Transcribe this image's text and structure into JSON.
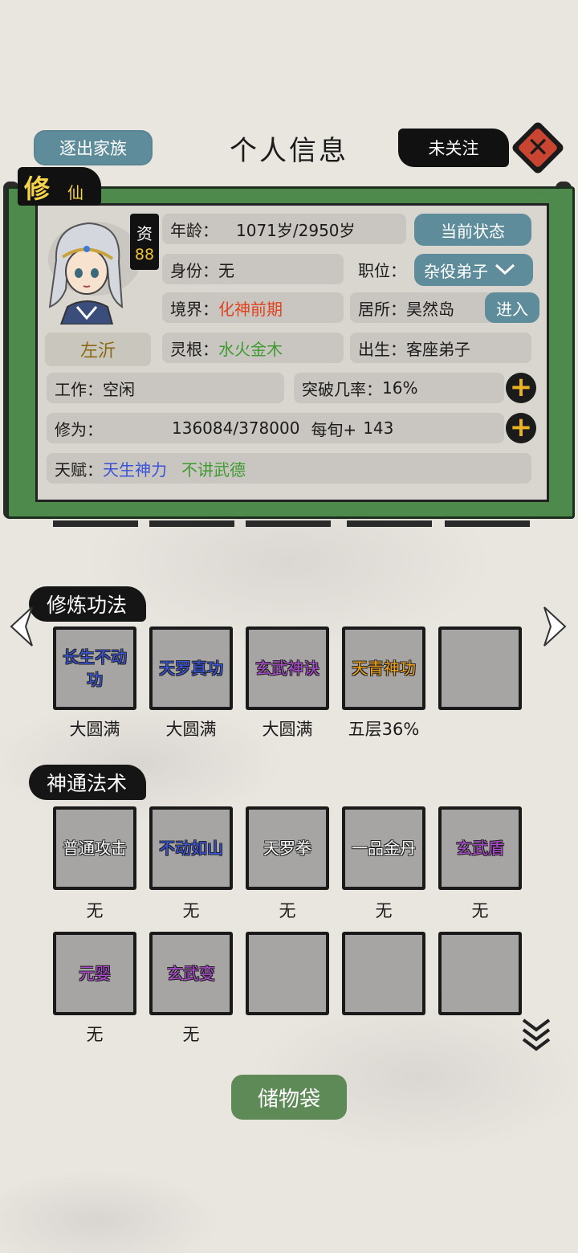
{
  "header": {
    "expel_label": "逐出家族",
    "title": "个人信息",
    "follow_label": "未关注",
    "close_icon": "close-icon"
  },
  "profile": {
    "panel_tag_big": "修",
    "panel_tag_small": "仙",
    "aptitude_label": "资",
    "aptitude_value": "88",
    "name": "左沂",
    "age_label": "年龄：",
    "age_value": "1071岁/2950岁",
    "status_button": "当前状态",
    "identity_label": "身份：",
    "identity_value": "无",
    "position_label": "职位：",
    "position_value": "杂役弟子",
    "realm_label": "境界：",
    "realm_value": "化神前期",
    "residence_label": "居所：",
    "residence_value": "昊然岛",
    "enter_button": "进入",
    "root_label": "灵根：",
    "root_value": "水火金木",
    "birth_label": "出生：",
    "birth_value": "客座弟子",
    "work_label": "工作：",
    "work_value": "空闲",
    "breakthrough_label": "突破几率：",
    "breakthrough_value": "16%",
    "cultivation_label": "修为：",
    "cultivation_value": "136084/378000",
    "per_turn_label": "每旬+",
    "per_turn_value": "143",
    "talent_label": "天赋：",
    "talents": [
      "天生神力",
      "不讲武德"
    ],
    "colors": {
      "realm": "#e0421e",
      "root": "#3f9a30",
      "talent1": "#3a52d6",
      "talent2": "#3f9a30"
    }
  },
  "techniques": {
    "title": "修炼功法",
    "items": [
      {
        "name": "长生不动功",
        "progress": "大圆满",
        "color": "#3b57e8"
      },
      {
        "name": "天罗真功",
        "progress": "大圆满",
        "color": "#3b57e8"
      },
      {
        "name": "玄武神诀",
        "progress": "大圆满",
        "color": "#b24bd6"
      },
      {
        "name": "天青神功",
        "progress": "五层36%",
        "color": "#f0a21d"
      },
      {
        "name": "",
        "progress": ""
      }
    ]
  },
  "skills": {
    "title": "神通法术",
    "items": [
      {
        "name": "普通攻击",
        "level": "无",
        "color": "#ffffff"
      },
      {
        "name": "不动如山",
        "level": "无",
        "color": "#3b57e8"
      },
      {
        "name": "天罗拳",
        "level": "无",
        "color": "#ffffff"
      },
      {
        "name": "一品金丹",
        "level": "无",
        "color": "#ffffff"
      },
      {
        "name": "玄武盾",
        "level": "无",
        "color": "#b24bd6"
      },
      {
        "name": "元婴",
        "level": "无",
        "color": "#b24bd6"
      },
      {
        "name": "玄武变",
        "level": "无",
        "color": "#b24bd6"
      },
      {
        "name": "",
        "level": ""
      },
      {
        "name": "",
        "level": ""
      },
      {
        "name": "",
        "level": ""
      }
    ]
  },
  "storage_label": "储物袋"
}
